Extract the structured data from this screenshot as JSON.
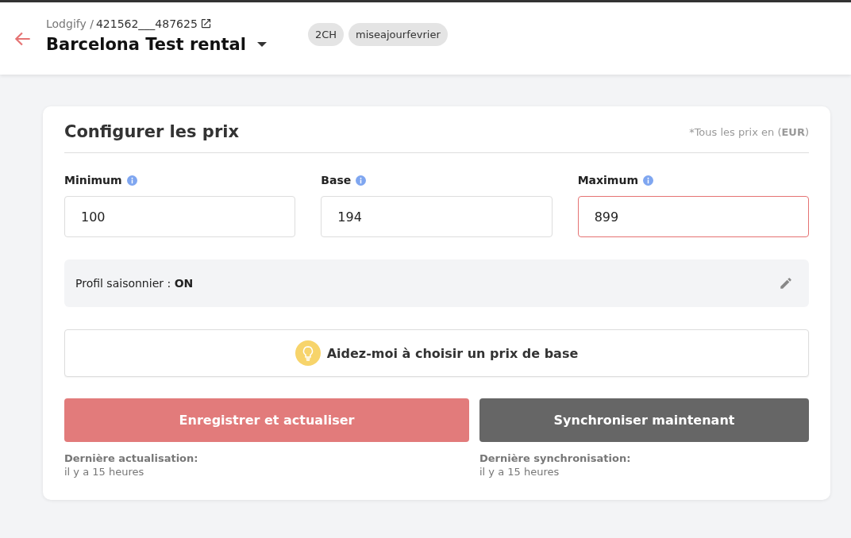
{
  "header": {
    "breadcrumb_prefix": "Lodgify /",
    "breadcrumb_id": "421562___487625",
    "title": "Barcelona Test rental",
    "tags": [
      "2CH",
      "miseajourfevrier"
    ]
  },
  "card": {
    "title": "Configurer les prix",
    "currency_note": "*Tous les prix en (**EUR**)",
    "fields": [
      {
        "label": "Minimum",
        "value": "100",
        "error": false
      },
      {
        "label": "Base",
        "value": "194",
        "error": false
      },
      {
        "label": "Maximum",
        "value": "899",
        "error": true
      }
    ],
    "profile": "Profil saisonnier : **ON**",
    "help_button": "Aidez-moi à choisir un prix de base",
    "actions": [
      {
        "kind": "primary",
        "label": "Enregistrer et actualiser",
        "status_label": "Dernière actualisation:",
        "status_value": "il y a 15 heures"
      },
      {
        "kind": "secondary",
        "label": "Synchroniser maintenant",
        "status_label": "Dernière synchronisation:",
        "status_value": "il y a 15 heures"
      }
    ]
  }
}
